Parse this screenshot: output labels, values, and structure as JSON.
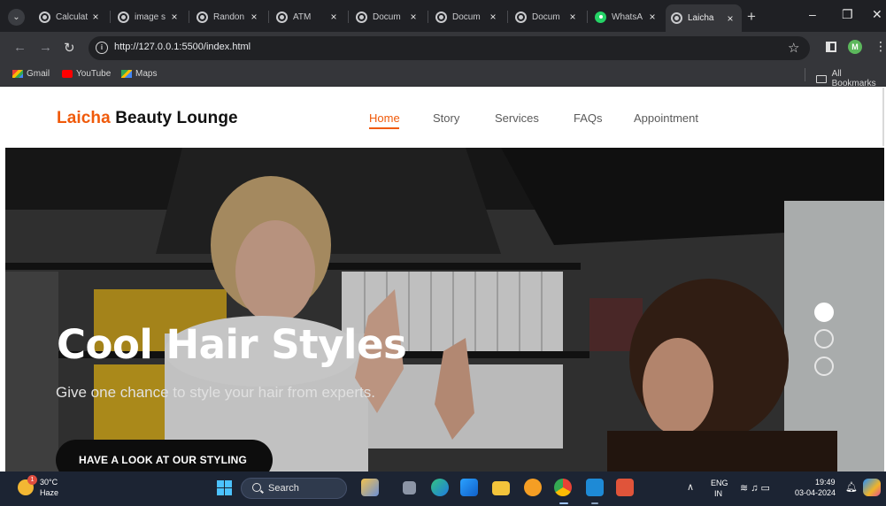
{
  "browser": {
    "tabs": [
      {
        "title": "Calculat",
        "icon": "globe-icon"
      },
      {
        "title": "image s",
        "icon": "globe-icon"
      },
      {
        "title": "Randon",
        "icon": "globe-icon"
      },
      {
        "title": "ATM",
        "icon": "globe-icon"
      },
      {
        "title": "Docum",
        "icon": "globe-icon"
      },
      {
        "title": "Docum",
        "icon": "globe-icon"
      },
      {
        "title": "Docum",
        "icon": "globe-icon"
      },
      {
        "title": "WhatsA",
        "icon": "whatsapp-icon"
      },
      {
        "title": "Laicha",
        "icon": "globe-icon",
        "active": true
      }
    ],
    "tab_close": "×",
    "new_tab": "+",
    "window_controls": {
      "minimize": "–",
      "restore": "❐",
      "close": "✕"
    },
    "url": "http://127.0.0.1:5500/index.html",
    "profile_initial": "M",
    "bookmarks": [
      {
        "label": "Gmail",
        "icon": "gmail-icon"
      },
      {
        "label": "YouTube",
        "icon": "youtube-icon"
      },
      {
        "label": "Maps",
        "icon": "maps-icon"
      }
    ],
    "all_bookmarks": "All Bookmarks"
  },
  "site": {
    "brand_accent": "Laicha",
    "brand_rest": "Beauty Lounge",
    "nav": [
      {
        "label": "Home",
        "active": true
      },
      {
        "label": "Story"
      },
      {
        "label": "Services"
      },
      {
        "label": "FAQs"
      },
      {
        "label": "Appointment"
      }
    ],
    "hero": {
      "title": "Cool Hair Styles",
      "subtitle": "Give one chance to style your hair from experts.",
      "cta": "HAVE A LOOK AT OUR STYLING",
      "slides": 3,
      "active_slide": 1
    },
    "colors": {
      "accent": "#f05a0a",
      "cta_bg": "#0d0d0d"
    }
  },
  "taskbar": {
    "weather_temp": "30°C",
    "weather_desc": "Haze",
    "weather_badge": "1",
    "search_label": "Search",
    "lang_line1": "ENG",
    "lang_line2": "IN",
    "time": "19:49",
    "date": "03-04-2024"
  }
}
